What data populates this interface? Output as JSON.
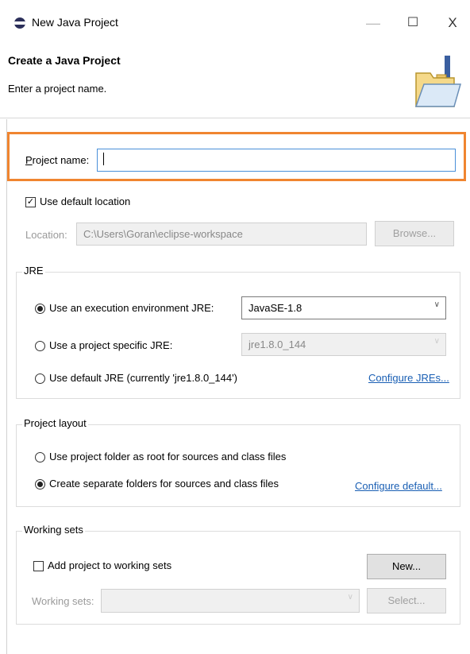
{
  "window": {
    "title": "New Java Project",
    "minimize_glyph": "—",
    "maximize_glyph": "☐",
    "close_glyph": "X"
  },
  "header": {
    "title": "Create a Java Project",
    "description": "Enter a project name."
  },
  "project_name": {
    "label": "Project name:",
    "value": ""
  },
  "location": {
    "use_default_label": "Use default location",
    "use_default_checked": true,
    "label": "Location:",
    "value": "C:\\Users\\Goran\\eclipse-workspace",
    "browse_label": "Browse..."
  },
  "jre": {
    "group_title": "JRE",
    "option_execution_env": "Use an execution environment JRE:",
    "execution_env_value": "JavaSE-1.8",
    "option_project_specific": "Use a project specific JRE:",
    "project_specific_value": "jre1.8.0_144",
    "option_default": "Use default JRE (currently 'jre1.8.0_144')",
    "configure_link": "Configure JREs..."
  },
  "project_layout": {
    "group_title": "Project layout",
    "option_root": "Use project folder as root for sources and class files",
    "option_separate": "Create separate folders for sources and class files",
    "configure_link": "Configure default..."
  },
  "working_sets": {
    "group_title": "Working sets",
    "add_label": "Add project to working sets",
    "new_button": "New...",
    "label": "Working sets:",
    "select_button": "Select..."
  }
}
